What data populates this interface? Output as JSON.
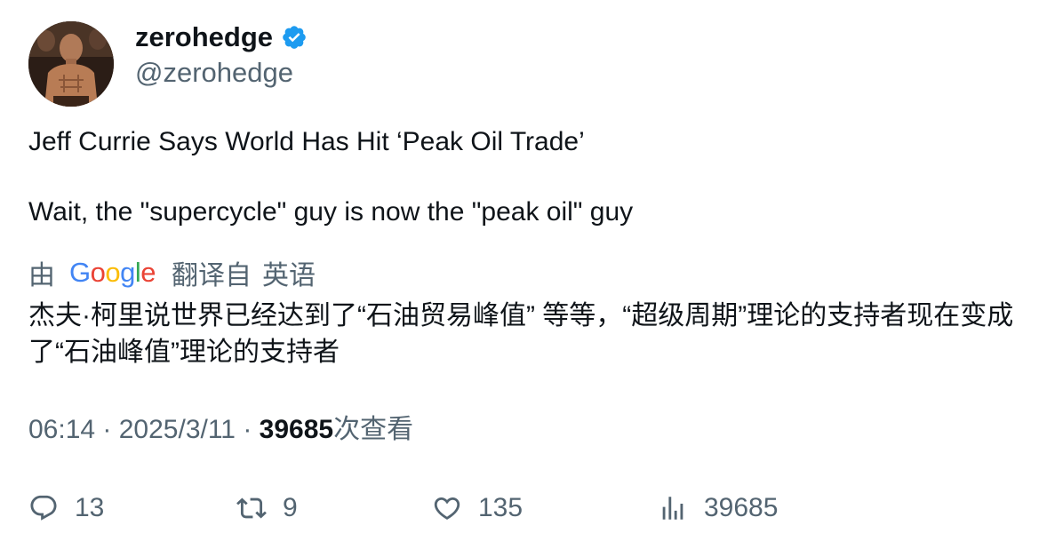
{
  "author": {
    "display_name": "zerohedge",
    "handle": "@zerohedge",
    "verified_icon": "verified-badge-icon",
    "verified_color": "#1d9bf0"
  },
  "tweet": {
    "line1": "Jeff Currie Says World Has Hit ‘Peak Oil Trade’",
    "line2": "Wait, the \"supercycle\" guy is now the \"peak oil\" guy"
  },
  "translation": {
    "prefix": "由",
    "provider": "Google",
    "suffix": "翻译自",
    "source_language": "英语",
    "text": "杰夫·柯里说世界已经达到了“石油贸易峰值” 等等，“超级周期”理论的支持者现在变成了“石油峰值”理论的支持者"
  },
  "meta": {
    "time": "06:14",
    "separator": "·",
    "date": "2025/3/11",
    "views_count": "39685",
    "views_label": "次查看"
  },
  "actions": {
    "reply_count": "13",
    "retweet_count": "9",
    "like_count": "135",
    "views_count": "39685"
  },
  "colors": {
    "text_primary": "#0f1419",
    "text_secondary": "#536471",
    "google_blue": "#4285f4",
    "google_red": "#ea4335",
    "google_yellow": "#fbbc05",
    "google_green": "#34a853"
  }
}
